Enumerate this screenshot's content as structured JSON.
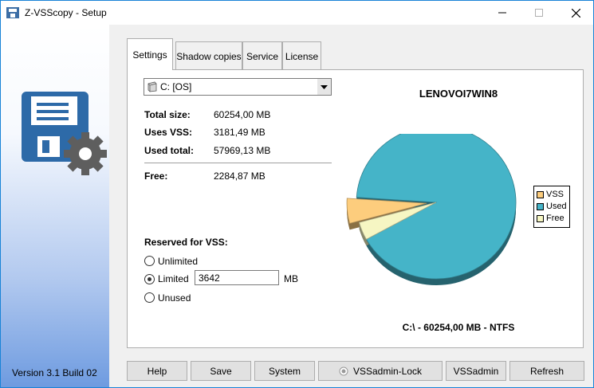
{
  "window": {
    "title": "Z-VSScopy - Setup",
    "version": "Version 3.1 Build 02"
  },
  "tabs": [
    {
      "label": "Settings",
      "active": true
    },
    {
      "label": "Shadow copies",
      "active": false
    },
    {
      "label": "Service",
      "active": false
    },
    {
      "label": "License",
      "active": false
    }
  ],
  "drive": {
    "selected": "C:  [OS]"
  },
  "stats": {
    "total_size_label": "Total size:",
    "total_size_value": "60254,00 MB",
    "uses_vss_label": "Uses VSS:",
    "uses_vss_value": "3181,49 MB",
    "used_total_label": "Used total:",
    "used_total_value": "57969,13 MB",
    "free_label": "Free:",
    "free_value": "2284,87 MB"
  },
  "reserved": {
    "title": "Reserved for VSS:",
    "options": [
      {
        "label": "Unlimited",
        "checked": false
      },
      {
        "label": "Limited",
        "checked": true
      },
      {
        "label": "Unused",
        "checked": false
      }
    ],
    "limit_value": "3642",
    "unit": "MB"
  },
  "chart_data": {
    "type": "pie",
    "title": "LENOVOI7WIN8",
    "footer": "C:\\ - 60254,00 MB - NTFS",
    "legend_position": "right",
    "slices": [
      {
        "name": "VSS",
        "value": 3181.49,
        "color": "#fdcd7d",
        "exploded": true
      },
      {
        "name": "Used",
        "value": 54787.64,
        "color": "#45b4c8",
        "exploded": false
      },
      {
        "name": "Free",
        "value": 2284.87,
        "color": "#f6f6c3",
        "exploded": false
      }
    ]
  },
  "buttons": {
    "help": "Help",
    "save": "Save",
    "system": "System",
    "vssadmin_lock": "VSSadmin-Lock",
    "vssadmin": "VSSadmin",
    "refresh": "Refresh"
  },
  "colors": {
    "accent": "#1883d7",
    "pie_used": "#45b4c8",
    "pie_vss": "#fdcd7d",
    "pie_free": "#f6f6c3"
  }
}
